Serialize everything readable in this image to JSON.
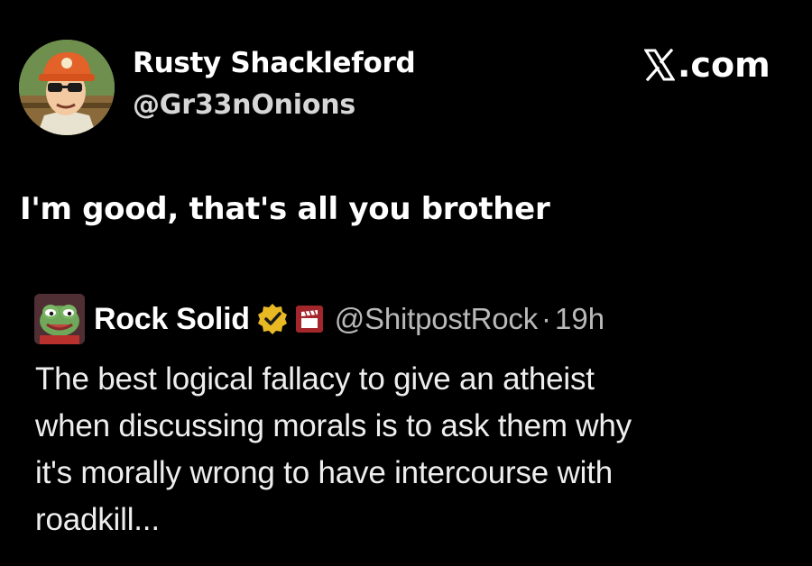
{
  "author": {
    "display_name": "Rusty Shackleford",
    "handle": "@Gr33nOnions",
    "avatar_icon": "cartoon-man-orange-cap-avatar"
  },
  "site": {
    "label": ".com",
    "icon": "x-logo-icon"
  },
  "tweet": {
    "text": "I'm good, that's all you brother"
  },
  "quoted_tweet": {
    "display_name": "Rock Solid",
    "verified_icon": "verified-badge-icon",
    "affiliate_icon": "clapperboard-icon",
    "handle": "@ShitpostRock",
    "separator": "·",
    "time": "19h",
    "lines": [
      "The best logical fallacy to give an atheist",
      "when discussing morals is to ask them why",
      "it's morally wrong to have intercourse with",
      "roadkill..."
    ]
  },
  "colors": {
    "background": "#000000",
    "text_primary": "#ffffff",
    "text_secondary": "#b9b9b9",
    "verified_gold": "#e8b923",
    "affiliate_red": "#a3262a"
  }
}
